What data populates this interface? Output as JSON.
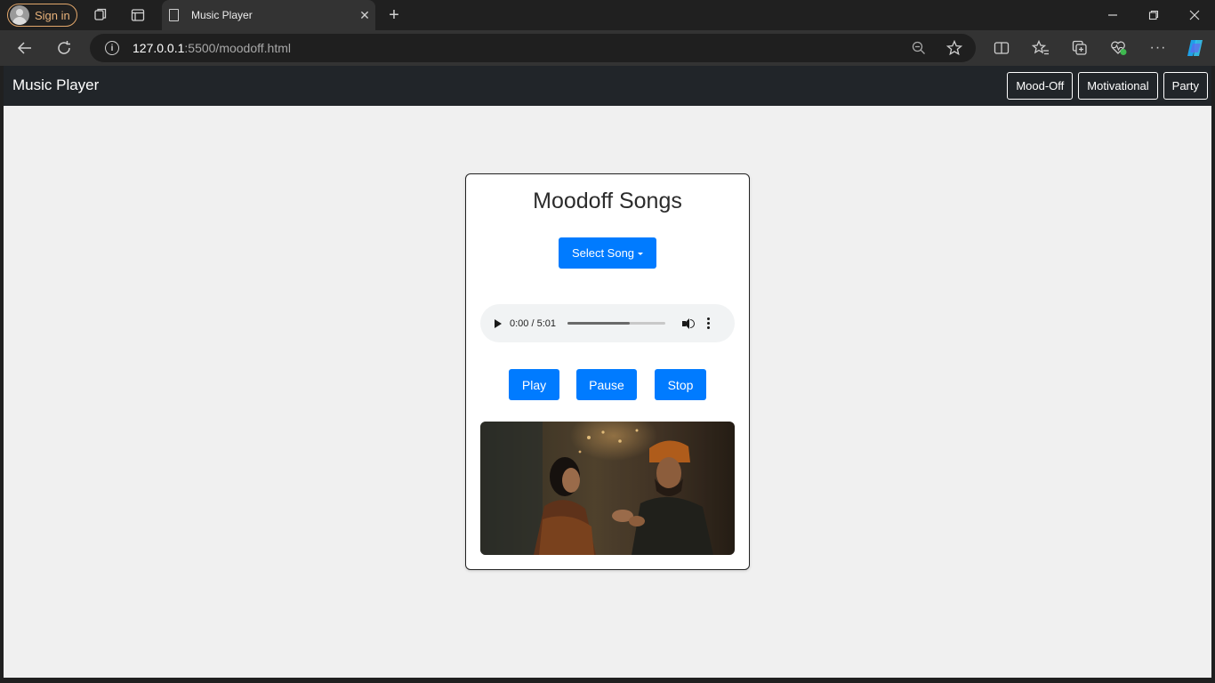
{
  "browser": {
    "signin_label": "Sign in",
    "tab_title": "Music Player",
    "url_host": "127.0.0.1",
    "url_rest": ":5500/moodoff.html"
  },
  "navbar": {
    "brand": "Music Player",
    "links": [
      "Mood-Off",
      "Motivational",
      "Party"
    ]
  },
  "player": {
    "heading": "Moodoff Songs",
    "select_label": "Select Song",
    "time_display": "0:00 / 5:01",
    "progress_fraction": 0.64,
    "controls": {
      "play": "Play",
      "pause": "Pause",
      "stop": "Stop"
    }
  },
  "colors": {
    "primary": "#007bff",
    "navbar_bg": "#212529",
    "page_bg": "#f0f0f0"
  }
}
